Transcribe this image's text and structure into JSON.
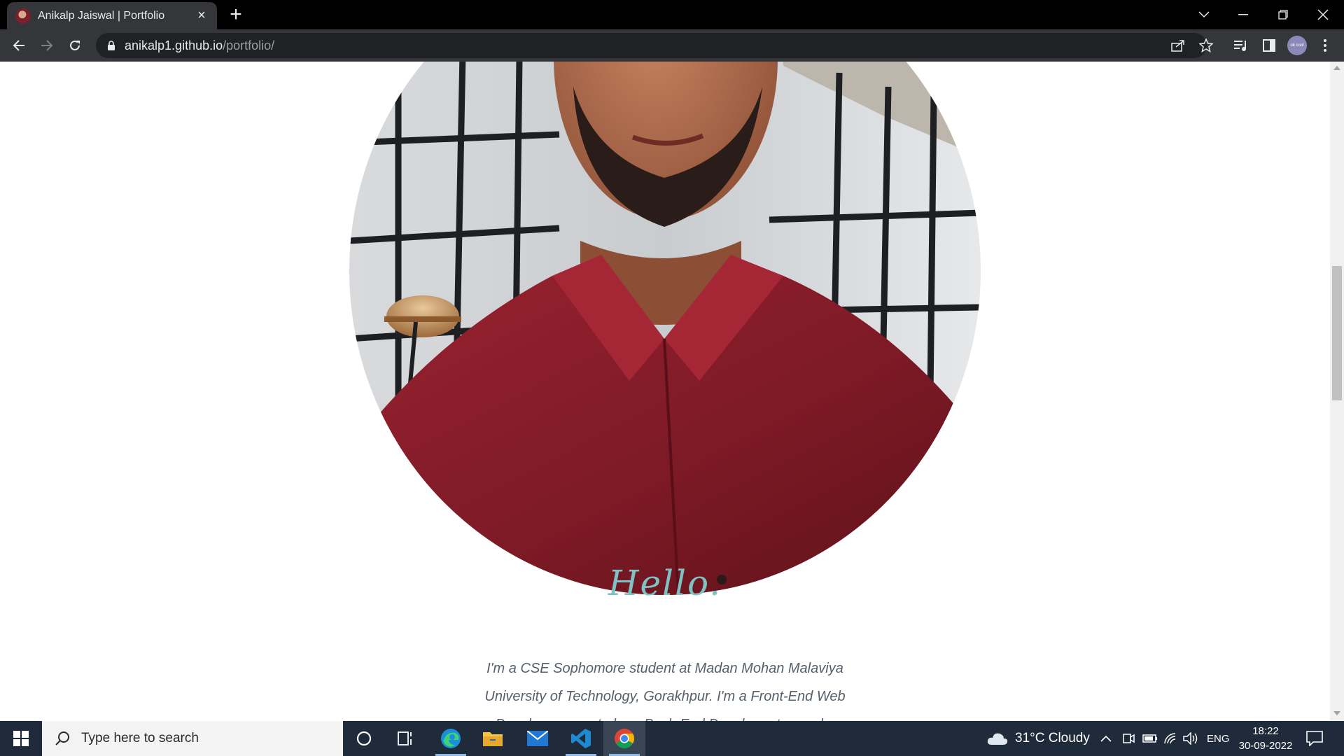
{
  "browser": {
    "tab": {
      "title": "Anikalp Jaiswal | Portfolio"
    },
    "url": {
      "host": "anikalp1.github.io",
      "path": "/portfolio/"
    },
    "profile_initials": "ok cool"
  },
  "page": {
    "greeting": "Hello.",
    "bio": "I'm a CSE Sophomore student at Madan Mohan Malaviya University of Technology, Gorakhpur. I'm a Front-End Web Developer soon to be a Back-End Developer too and a"
  },
  "taskbar": {
    "search_placeholder": "Type here to search",
    "weather": "31°C  Cloudy",
    "language": "ENG",
    "time": "18:22",
    "date": "30-09-2022"
  },
  "colors": {
    "hello_accent": "#7ec2c4",
    "shirt": "#8a1e2a",
    "taskbar": "#1f2a3a"
  }
}
